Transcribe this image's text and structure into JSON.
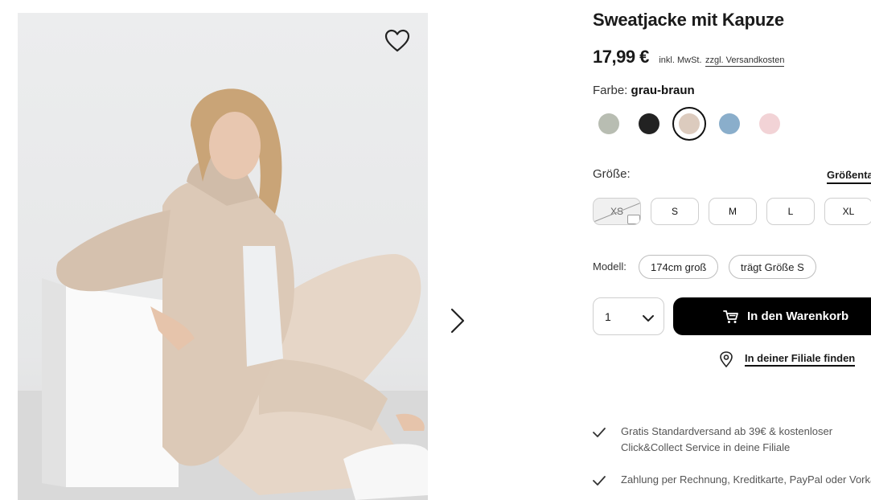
{
  "product": {
    "title": "Sweatjacke mit Kapuze",
    "price": "17,99 €",
    "tax_note": "inkl. MwSt.",
    "shipping_link": "zzgl. Versandkosten",
    "color_prefix": "Farbe:",
    "color_name": "grau-braun",
    "swatches": [
      {
        "name": "grün-grau",
        "color": "#b8bdb2"
      },
      {
        "name": "schwarz",
        "color": "#222222"
      },
      {
        "name": "grau-braun",
        "color": "#dccbbe",
        "selected": true
      },
      {
        "name": "blau",
        "color": "#8aaecb"
      },
      {
        "name": "rosa",
        "color": "#f2d3d6"
      }
    ],
    "size_label": "Größe:",
    "size_guide": "Größentabelle",
    "sizes": [
      {
        "label": "XS",
        "available": false
      },
      {
        "label": "S",
        "available": true
      },
      {
        "label": "M",
        "available": true
      },
      {
        "label": "L",
        "available": true
      },
      {
        "label": "XL",
        "available": true
      }
    ],
    "model_label": "Modell:",
    "model_height": "174cm groß",
    "model_size": "trägt Größe S",
    "quantity": "1",
    "add_to_cart": "In den Warenkorb",
    "store_finder": "In deiner Filiale finden",
    "usps": [
      {
        "line1": "Gratis Standardversand ab 39€ & kostenloser",
        "line2": "Click&Collect Service in deine Filiale"
      },
      {
        "line1": "Zahlung per Rechnung, Kreditkarte, PayPal oder Vorkasse",
        "line2": ""
      }
    ]
  },
  "icons": {
    "wishlist": "heart-icon",
    "next": "chevron-right-icon",
    "cart": "cart-icon",
    "location": "location-pin-icon",
    "check": "check-icon"
  },
  "colors": {
    "accent": "#000000",
    "jacket": "#d9c7b6"
  }
}
